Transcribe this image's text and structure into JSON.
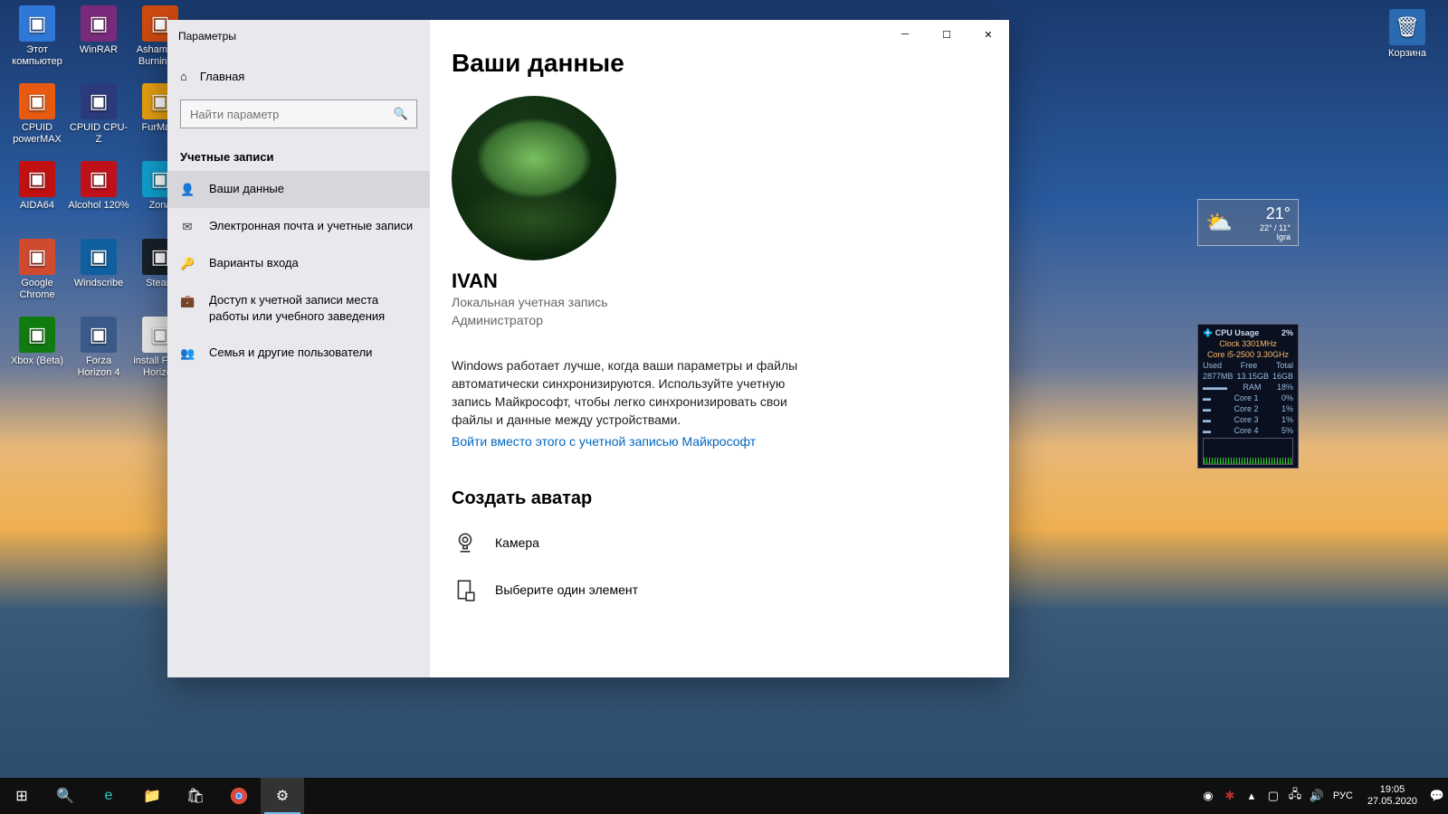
{
  "desktop_icons": [
    {
      "label": "Этот\nкомпьютер",
      "row": 0,
      "col": 0,
      "bg": "#3078d7"
    },
    {
      "label": "WinRAR",
      "row": 0,
      "col": 1,
      "bg": "#7a2a7a"
    },
    {
      "label": "Ashampoo\nBurning S",
      "row": 0,
      "col": 2,
      "bg": "#d04a10"
    },
    {
      "label": "CPUID\npowerMAX",
      "row": 1,
      "col": 0,
      "bg": "#e85a10"
    },
    {
      "label": "CPUID CPU-Z",
      "row": 1,
      "col": 1,
      "bg": "#2a3a7a"
    },
    {
      "label": "FurMark",
      "row": 1,
      "col": 2,
      "bg": "#e8a010"
    },
    {
      "label": "AIDA64",
      "row": 2,
      "col": 0,
      "bg": "#c01010"
    },
    {
      "label": "Alcohol 120%",
      "row": 2,
      "col": 1,
      "bg": "#c0101a"
    },
    {
      "label": "Zona",
      "row": 2,
      "col": 2,
      "bg": "#10a0d0"
    },
    {
      "label": "Google\nChrome",
      "row": 3,
      "col": 0,
      "bg": "#d04a30"
    },
    {
      "label": "Windscribe",
      "row": 3,
      "col": 1,
      "bg": "#1060a0"
    },
    {
      "label": "Steam",
      "row": 3,
      "col": 2,
      "bg": "#18202a"
    },
    {
      "label": "Xbox (Beta)",
      "row": 4,
      "col": 0,
      "bg": "#107c10"
    },
    {
      "label": "Forza\nHorizon 4",
      "row": 4,
      "col": 1,
      "bg": "#3a5a8a"
    },
    {
      "label": "install Forza\nHorizon",
      "row": 4,
      "col": 2,
      "bg": "#e8e8e8"
    }
  ],
  "recycle_label": "Корзина",
  "window": {
    "title": "Параметры",
    "home_label": "Главная",
    "search_placeholder": "Найти параметр",
    "section": "Учетные записи",
    "nav": [
      {
        "icon": "person",
        "label": "Ваши данные",
        "active": true
      },
      {
        "icon": "mail",
        "label": "Электронная почта и учетные записи"
      },
      {
        "icon": "key",
        "label": "Варианты входа"
      },
      {
        "icon": "briefcase",
        "label": "Доступ к учетной записи места работы или учебного заведения"
      },
      {
        "icon": "people",
        "label": "Семья и другие пользователи"
      }
    ],
    "page_heading": "Ваши данные",
    "username": "IVAN",
    "account_type": "Локальная учетная запись",
    "role": "Администратор",
    "info_text": "Windows работает лучше, когда ваши параметры и файлы автоматически синхронизируются. Используйте учетную запись Майкрософт, чтобы легко синхронизировать свои файлы и данные между устройствами.",
    "signin_link": "Войти вместо этого с учетной записью Майкрософт",
    "avatar_heading": "Создать аватар",
    "option_camera": "Камера",
    "option_browse": "Выберите один элемент"
  },
  "weather": {
    "temp": "21°",
    "range": "22° / 11°",
    "city": "Igra"
  },
  "cpu": {
    "title": "CPU Usage",
    "pct": "2%",
    "clock": "Clock 3301MHz",
    "model": "Core i5-2500 3.30GHz",
    "used_label": "Used",
    "free_label": "Free",
    "total_label": "Total",
    "used": "2877MB",
    "free": "13.15GB",
    "total": "16GB",
    "ram_label": "RAM",
    "ram_pct": "18%",
    "cores": [
      {
        "n": "Core 1",
        "v": "0%"
      },
      {
        "n": "Core 2",
        "v": "1%"
      },
      {
        "n": "Core 3",
        "v": "1%"
      },
      {
        "n": "Core 4",
        "v": "5%"
      }
    ]
  },
  "taskbar": {
    "lang": "РУС",
    "time": "19:05",
    "date": "27.05.2020"
  }
}
